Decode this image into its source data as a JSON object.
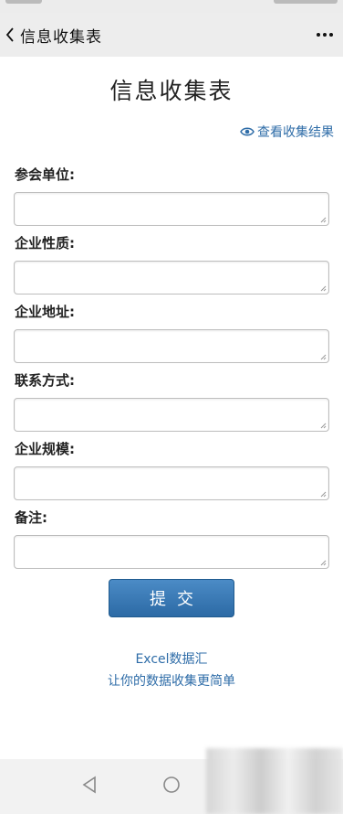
{
  "nav": {
    "title": "信息收集表",
    "back_icon": "chevron-left-icon",
    "more_icon": "more-dots-icon"
  },
  "page": {
    "title": "信息收集表",
    "view_results_label": "查看收集结果",
    "view_results_icon": "eye-icon"
  },
  "form": {
    "fields": [
      {
        "label": "参会单位:",
        "value": ""
      },
      {
        "label": "企业性质:",
        "value": ""
      },
      {
        "label": "企业地址:",
        "value": ""
      },
      {
        "label": "联系方式:",
        "value": ""
      },
      {
        "label": "企业规模:",
        "value": ""
      },
      {
        "label": "备注:",
        "value": ""
      }
    ],
    "submit_label": "提交"
  },
  "footer": {
    "link": "Excel数据汇",
    "tagline": "让你的数据收集更简单"
  },
  "system_nav": {
    "back_icon": "triangle-back-icon",
    "home_icon": "circle-home-icon"
  },
  "colors": {
    "link": "#2f6da8",
    "button": "#2c6aa5",
    "nav_bg": "#ededed"
  }
}
